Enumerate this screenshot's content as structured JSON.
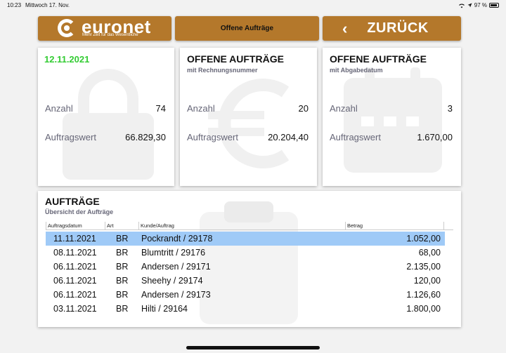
{
  "status_bar": {
    "time": "10:23",
    "date": "Mittwoch 17. Nov.",
    "battery": "97 %"
  },
  "header": {
    "logo_name": "euronet",
    "logo_tagline": "Mehr Zeit für das Wesentliche",
    "title": "Offene Aufträge",
    "back_label": "ZURÜCK",
    "back_icon": "chevron-left-icon"
  },
  "colors": {
    "brand": "#b4782b",
    "date_green": "#33cc33",
    "selection": "#9fcaf7"
  },
  "cards": [
    {
      "date": "12.11.2021",
      "watermark": "lock-icon",
      "count_label": "Anzahl",
      "count": "74",
      "value_label": "Auftragswert",
      "value": "66.829,30"
    },
    {
      "title": "OFFENE AUFTRÄGE",
      "subtitle": "mit Rechnungsnummer",
      "watermark": "euro-icon",
      "count_label": "Anzahl",
      "count": "20",
      "value_label": "Auftragswert",
      "value": "20.204,40"
    },
    {
      "title": "OFFENE AUFTRÄGE",
      "subtitle": "mit Abgabedatum",
      "watermark": "calendar-icon",
      "count_label": "Anzahl",
      "count": "3",
      "value_label": "Auftragswert",
      "value": "1.670,00"
    }
  ],
  "orders": {
    "title": "AUFTRÄGE",
    "subtitle": "Übersicht der Aufträge",
    "columns": [
      "Auftragsdatum",
      "Art",
      "Kunde/Auftrag",
      "Betrag"
    ],
    "rows": [
      {
        "date": "11.11.2021",
        "art": "BR",
        "kunde": "Pockrandt / 29178",
        "betrag": "1.052,00",
        "selected": true
      },
      {
        "date": "08.11.2021",
        "art": "BR",
        "kunde": "Blumtritt / 29176",
        "betrag": "68,00"
      },
      {
        "date": "06.11.2021",
        "art": "BR",
        "kunde": "Andersen / 29171",
        "betrag": "2.135,00"
      },
      {
        "date": "06.11.2021",
        "art": "BR",
        "kunde": "Sheehy / 29174",
        "betrag": "120,00"
      },
      {
        "date": "06.11.2021",
        "art": "BR",
        "kunde": "Andersen / 29173",
        "betrag": "1.126,60"
      },
      {
        "date": "03.11.2021",
        "art": "BR",
        "kunde": "Hilti / 29164",
        "betrag": "1.800,00"
      }
    ]
  }
}
